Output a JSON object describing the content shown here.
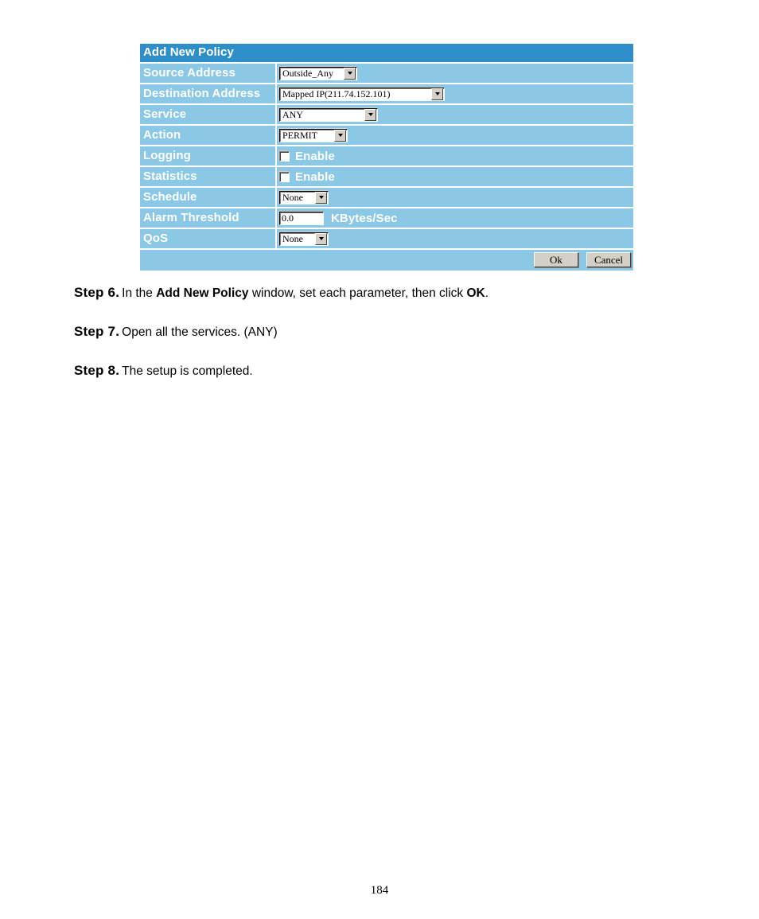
{
  "dialog": {
    "title": "Add New Policy",
    "rows": [
      {
        "label": "Source Address",
        "control": "select",
        "value": "Outside_Any",
        "class": "sel-source"
      },
      {
        "label": "Destination Address",
        "control": "select",
        "value": "Mapped IP(211.74.152.101)",
        "class": "sel-dest"
      },
      {
        "label": "Service",
        "control": "select",
        "value": "ANY",
        "class": "sel-service"
      },
      {
        "label": "Action",
        "control": "select",
        "value": "PERMIT",
        "class": "sel-action"
      },
      {
        "label": "Logging",
        "control": "checkbox",
        "value": "Enable",
        "checked": false
      },
      {
        "label": "Statistics",
        "control": "checkbox",
        "value": "Enable",
        "checked": false
      },
      {
        "label": "Schedule",
        "control": "select",
        "value": "None",
        "class": "sel-sched"
      },
      {
        "label": "Alarm Threshold",
        "control": "text",
        "value": "0.0",
        "unit": "KBytes/Sec"
      },
      {
        "label": "QoS",
        "control": "select",
        "value": "None",
        "class": "sel-qos"
      }
    ],
    "buttons": {
      "ok": "Ok",
      "cancel": "Cancel"
    },
    "colors": {
      "header_blue": "#2e8fc8",
      "row_blue": "#8ac8e6",
      "label_text": "#ffffff",
      "button_face": "#d4d0c8"
    }
  },
  "steps": [
    {
      "label": "Step 6.",
      "pre": "In the ",
      "bold": "Add New Policy",
      "mid": " window, set each parameter, then click ",
      "bold2": "OK",
      "post": "."
    },
    {
      "label": "Step 7.",
      "pre": "Open all the services. (ANY)",
      "bold": "",
      "mid": "",
      "bold2": "",
      "post": ""
    },
    {
      "label": "Step 8.",
      "pre": "The setup is completed.",
      "bold": "",
      "mid": "",
      "bold2": "",
      "post": ""
    }
  ],
  "footer": {
    "page_number": "184"
  }
}
